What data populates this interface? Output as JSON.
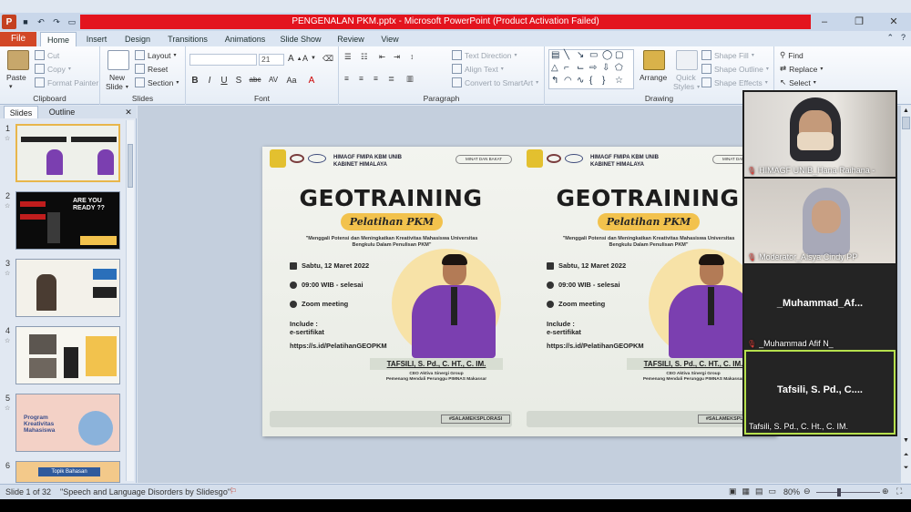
{
  "titlebar": {
    "title": "PENGENALAN PKM.pptx  -  Microsoft PowerPoint (Product Activation Failed)",
    "app_logo": "P"
  },
  "tabs": {
    "file": "File",
    "items": [
      "Home",
      "Insert",
      "Design",
      "Transitions",
      "Animations",
      "Slide Show",
      "Review",
      "View"
    ],
    "active": "Home"
  },
  "ribbon": {
    "clipboard": {
      "label": "Clipboard",
      "paste": "Paste",
      "cut": "Cut",
      "copy": "Copy",
      "format_painter": "Format Painter"
    },
    "slides": {
      "label": "Slides",
      "new_slide_line1": "New",
      "new_slide_line2": "Slide",
      "layout": "Layout",
      "reset": "Reset",
      "section": "Section"
    },
    "font": {
      "label": "Font",
      "font_name": "",
      "font_size": "21",
      "buttons": [
        "B",
        "I",
        "U",
        "S",
        "abc",
        "AV",
        "Aa",
        "A"
      ]
    },
    "paragraph": {
      "label": "Paragraph",
      "text_direction": "Text Direction",
      "align_text": "Align Text",
      "convert_smartart": "Convert to SmartArt"
    },
    "drawing": {
      "label": "Drawing",
      "arrange": "Arrange",
      "quick_styles_line1": "Quick",
      "quick_styles_line2": "Styles",
      "shape_fill": "Shape Fill",
      "shape_outline": "Shape Outline",
      "shape_effects": "Shape Effects"
    },
    "editing": {
      "find": "Find",
      "replace": "Replace",
      "select": "Select"
    }
  },
  "panel": {
    "tabs": [
      "Slides",
      "Outline"
    ],
    "active_tab": "Slides",
    "slide_numbers": [
      "1",
      "2",
      "3",
      "4",
      "5",
      "6"
    ],
    "thumb2_text": "ARE YOU READY ??",
    "thumb5_text": "Program Kreativitas Mahasiswa",
    "thumb6_text": "Topik Bahasan"
  },
  "slide": {
    "org_line1": "HIMAGF FMIPA KBM UNIB",
    "org_line2": "KABINET HIMALAYA",
    "tag": "MINAT DAN BAKAT",
    "title": "GEOTRAINING",
    "subtitle": "Pelatihan PKM",
    "theme_line1": "\"Menggali Potensi dan Meningkatkan Kreativitas Mahasiswa Universitas",
    "theme_line2": "Bengkulu Dalam Penulisan PKM\"",
    "date": "Sabtu, 12 Maret 2022",
    "time": "09:00 WIB - selesai",
    "venue": "Zoom meeting",
    "include_line1": "Include :",
    "include_line2": "e-sertifikat",
    "link": "https://s.id/PelatihanGEOPKM",
    "speaker_name": "TAFSILI, S. Pd., C. HT., C. IM.",
    "speaker_role1": "CEO Aktiva Sinergi Group",
    "speaker_role2": "Pemenang Mendali Perunggu PIMNAS Makassar",
    "hashtag": "#SALAMEKSPLORASI"
  },
  "gallery": {
    "tiles": [
      {
        "name": "HIMAGF UNIB_Hana Raihana -"
      },
      {
        "name": "Moderator_Aisya Cindy PP"
      },
      {
        "center": "_Muhammad_Af...",
        "name": "_Muhammad Afif N_"
      },
      {
        "center": "Tafsili, S. Pd., C....",
        "name": "Tafsili, S. Pd., C. Ht., C. IM."
      }
    ]
  },
  "status": {
    "slide_count": "Slide 1 of 32",
    "theme": "\"Speech and Language Disorders by Slidesgo\"",
    "zoom": "80%"
  },
  "colors": {
    "title_bar_alert": "#e3141e",
    "file_tab": "#d24726",
    "active_speaker": "#b6e04d",
    "poster_accent": "#f2c24d",
    "shirt": "#7b3fb0"
  }
}
